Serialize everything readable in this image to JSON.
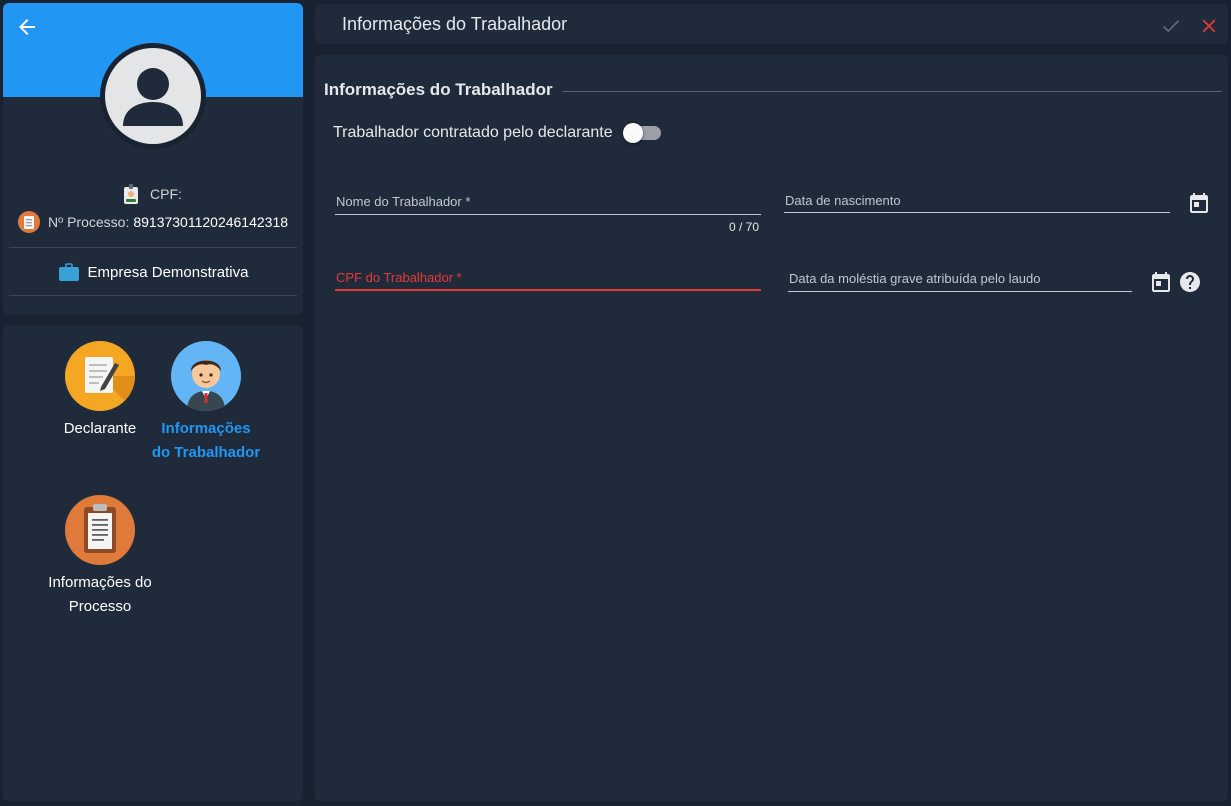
{
  "header": {
    "title": "Informações do Trabalhador"
  },
  "profile": {
    "cpf_label": "CPF:",
    "cpf_value": "",
    "process_label": "Nº Processo:",
    "process_value": "89137301120246142318",
    "company": "Empresa Demonstrativa"
  },
  "nav": {
    "items": [
      {
        "label": "Declarante",
        "active": false
      },
      {
        "label": "Informações do Trabalhador",
        "active": true
      },
      {
        "label": "Informações do Processo",
        "active": false
      }
    ]
  },
  "form": {
    "section_title": "Informações do Trabalhador",
    "toggle_label": "Trabalhador contratado pelo declarante",
    "toggle_on": false,
    "name_label": "Nome do Trabalhador *",
    "name_counter": "0 / 70",
    "birth_label": "Data de nascimento",
    "cpf_label": "CPF do Trabalhador *",
    "disease_label": "Data da moléstia grave atribuída pelo laudo"
  },
  "colors": {
    "accent": "#2196f3",
    "error": "#e53935",
    "background": "#182230",
    "card": "#1f2b3a"
  },
  "icons": {
    "back": "arrow-left-icon",
    "confirm": "check-icon",
    "close": "close-icon",
    "calendar": "calendar-icon",
    "help": "help-icon"
  }
}
